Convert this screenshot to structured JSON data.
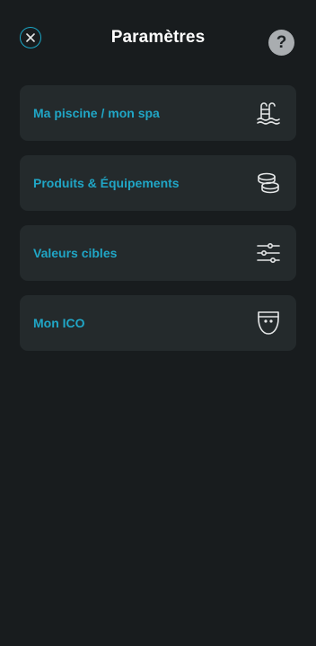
{
  "header": {
    "title": "Paramètres",
    "help_label": "?",
    "close_icon": "close-icon"
  },
  "menu": {
    "items": [
      {
        "label": "Ma piscine / mon spa",
        "icon": "pool-ladder-icon"
      },
      {
        "label": "Produits & Équipements",
        "icon": "tablets-stack-icon"
      },
      {
        "label": "Valeurs cibles",
        "icon": "sliders-icon"
      },
      {
        "label": "Mon ICO",
        "icon": "ico-device-icon"
      }
    ]
  },
  "colors": {
    "background": "#181c1e",
    "card": "#242a2c",
    "accent": "#20a6c6",
    "title": "#ffffff",
    "icon": "#e4e6e7",
    "help_bg": "#a9adb0"
  }
}
